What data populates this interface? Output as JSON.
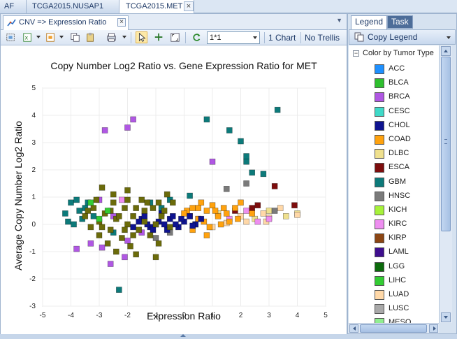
{
  "doc_tabs": [
    {
      "label": "AF"
    },
    {
      "label": "TCGA2015.NUSAP1"
    },
    {
      "label": "TCGA2015.MET"
    }
  ],
  "chart_tab": {
    "label": "CNV => Expression Ratio",
    "close": "×"
  },
  "toolbar": {
    "layout_value": "1*1",
    "chart_count_label": "1 Chart",
    "trellis_label": "No Trellis"
  },
  "right_panel": {
    "tabs": [
      {
        "label": "Legend"
      },
      {
        "label": "Task"
      }
    ],
    "copy_legend_label": "Copy Legend",
    "legend_title": "Color by Tumor Type",
    "legend_items": [
      {
        "label": "ACC",
        "color": "#1e90ff"
      },
      {
        "label": "BLCA",
        "color": "#2ebf2e"
      },
      {
        "label": "BRCA",
        "color": "#b057e3"
      },
      {
        "label": "CESC",
        "color": "#3fd9c8"
      },
      {
        "label": "CHOL",
        "color": "#0e1390"
      },
      {
        "label": "COAD",
        "color": "#ffa20e"
      },
      {
        "label": "DLBC",
        "color": "#efe08e"
      },
      {
        "label": "ESCA",
        "color": "#7d0d0d"
      },
      {
        "label": "GBM",
        "color": "#0c7a7a"
      },
      {
        "label": "HNSC",
        "color": "#7a7a7a"
      },
      {
        "label": "KICH",
        "color": "#a6f23a"
      },
      {
        "label": "KIRC",
        "color": "#ee8ef0"
      },
      {
        "label": "KIRP",
        "color": "#8b4513"
      },
      {
        "label": "LAML",
        "color": "#3e0e8e"
      },
      {
        "label": "LGG",
        "color": "#0c6a0c"
      },
      {
        "label": "LIHC",
        "color": "#33cc33"
      },
      {
        "label": "LUAD",
        "color": "#ffd8a8"
      },
      {
        "label": "LUSC",
        "color": "#a9a9a9"
      },
      {
        "label": "MESO",
        "color": "#90ee90"
      }
    ]
  },
  "chart_data": {
    "type": "scatter",
    "title": "Copy Number Log2 Ratio vs. Gene Expression Ratio for MET",
    "xlabel": "Expression Ratio",
    "ylabel": "Average Copy Number Log2 Ratio",
    "xlim": [
      -5,
      5
    ],
    "ylim": [
      -3,
      5
    ],
    "xticks": [
      "-5",
      "-4",
      "-3",
      "-2",
      "-1",
      "0",
      "1",
      "2",
      "3",
      "4",
      "5"
    ],
    "yticks": [
      "-3",
      "-2",
      "-1",
      "0",
      "1",
      "2",
      "3",
      "4",
      "5"
    ],
    "grid": true,
    "legend_placement": "side panel",
    "series": [
      {
        "label": "ESCA",
        "color": "#7d0d0d",
        "points": [
          [
            3.2,
            1.4
          ],
          [
            2.4,
            0.6
          ],
          [
            3.9,
            0.7
          ],
          [
            2.6,
            0.7
          ],
          [
            1.8,
            0.5
          ]
        ]
      },
      {
        "label": "DLBC",
        "color": "#efe08e",
        "points": [
          [
            3.6,
            0.3
          ],
          [
            3.0,
            0.5
          ],
          [
            2.5,
            0.2
          ],
          [
            4.0,
            0.4
          ],
          [
            1.2,
            0.4
          ]
        ]
      },
      {
        "label": "LUAD",
        "color": "#ffd8a8",
        "points": [
          [
            4.0,
            0.35
          ],
          [
            2.8,
            0.4
          ],
          [
            3.4,
            0.6
          ],
          [
            2.2,
            0.1
          ],
          [
            1.5,
            0.05
          ],
          [
            2.0,
            0.3
          ],
          [
            2.9,
            0.1
          ],
          [
            1.0,
            -0.1
          ],
          [
            3.0,
            0.25
          ]
        ]
      },
      {
        "label": "BRCA",
        "color": "#b057e3",
        "points": [
          [
            -2.8,
            3.45
          ],
          [
            -2.0,
            3.55
          ],
          [
            -1.8,
            3.85
          ],
          [
            1.0,
            2.3
          ],
          [
            -2.9,
            -0.85
          ],
          [
            -2.6,
            -1.45
          ],
          [
            -2.1,
            -1.2
          ],
          [
            -3.0,
            0.9
          ],
          [
            -3.3,
            -0.7
          ],
          [
            -2.0,
            -0.6
          ],
          [
            0.5,
            0.2
          ],
          [
            -1.5,
            -0.3
          ],
          [
            -2.5,
            0.3
          ],
          [
            -3.8,
            -0.9
          ]
        ]
      },
      {
        "label": "KIRC",
        "color": "#ee8ef0",
        "points": [
          [
            2.6,
            0.1
          ],
          [
            3.0,
            0.2
          ],
          [
            1.6,
            0.2
          ],
          [
            -2.2,
            0.9
          ],
          [
            2.2,
            0.5
          ]
        ]
      },
      {
        "label": "HNSC",
        "color": "#7a7a7a",
        "points": [
          [
            2.2,
            1.5
          ],
          [
            3.2,
            0.5
          ],
          [
            -1.0,
            -0.5
          ],
          [
            1.5,
            1.3
          ],
          [
            -0.5,
            -0.3
          ]
        ]
      },
      {
        "label": "COAD",
        "color": "#ffa20e",
        "points": [
          [
            0.3,
            0.6
          ],
          [
            0.8,
            0.5
          ],
          [
            1.2,
            0.3
          ],
          [
            0.5,
            0.2
          ],
          [
            1.0,
            0.7
          ],
          [
            0.2,
            0.3
          ],
          [
            1.5,
            0.4
          ],
          [
            0.7,
            0.1
          ],
          [
            1.8,
            0.6
          ],
          [
            0.9,
            -0.1
          ],
          [
            0.1,
            0.5
          ],
          [
            1.3,
            0.0
          ],
          [
            0.6,
            0.8
          ],
          [
            0.4,
            0.0
          ],
          [
            1.1,
            0.5
          ],
          [
            2.0,
            0.8
          ],
          [
            0.8,
            -0.4
          ],
          [
            1.6,
            0.1
          ],
          [
            0.5,
            0.6
          ],
          [
            0.0,
            0.4
          ],
          [
            1.4,
            0.6
          ],
          [
            0.3,
            -0.2
          ],
          [
            1.9,
            0.2
          ],
          [
            2.4,
            0.4
          ]
        ]
      },
      {
        "label": "GBM",
        "color": "#0c7a7a",
        "points": [
          [
            3.3,
            4.2
          ],
          [
            0.8,
            3.85
          ],
          [
            1.6,
            3.45
          ],
          [
            2.0,
            3.05
          ],
          [
            2.2,
            2.5
          ],
          [
            2.2,
            2.3
          ],
          [
            2.4,
            1.9
          ],
          [
            2.8,
            1.85
          ],
          [
            -4.0,
            0.8
          ],
          [
            -3.8,
            0.9
          ],
          [
            -3.5,
            0.6
          ],
          [
            -4.2,
            0.4
          ],
          [
            -3.6,
            0.2
          ],
          [
            -3.9,
            0.0
          ],
          [
            -3.7,
            0.5
          ],
          [
            -3.4,
            0.8
          ],
          [
            -4.1,
            0.1
          ],
          [
            -3.2,
            0.3
          ],
          [
            -1.2,
            0.8
          ],
          [
            0.2,
            1.05
          ],
          [
            -0.8,
            0.6
          ],
          [
            -2.5,
            -0.3
          ],
          [
            -2.3,
            -2.4
          ],
          [
            -0.5,
            0.9
          ]
        ]
      },
      {
        "label": "CHOL",
        "color": "#0e1390",
        "points": [
          [
            -0.5,
            0.2
          ],
          [
            -1.0,
            0.0
          ],
          [
            0.0,
            0.1
          ],
          [
            -1.5,
            0.2
          ],
          [
            -0.2,
            -0.1
          ],
          [
            -0.8,
            0.4
          ],
          [
            0.4,
            0.0
          ],
          [
            -1.2,
            -0.1
          ],
          [
            -0.6,
            -0.2
          ],
          [
            -1.6,
            0.1
          ],
          [
            0.2,
            0.3
          ],
          [
            -0.3,
            0.0
          ],
          [
            -1.4,
            0.3
          ],
          [
            -0.9,
            0.1
          ],
          [
            0.6,
            0.2
          ],
          [
            -0.1,
            0.2
          ],
          [
            -1.1,
            -0.2
          ],
          [
            -0.7,
            0.0
          ],
          [
            -1.8,
            -0.1
          ],
          [
            0.3,
            -0.05
          ],
          [
            -0.4,
            0.3
          ],
          [
            -1.3,
            0.0
          ]
        ]
      },
      {
        "label": "LGG",
        "color": "#6b6b0a",
        "points": [
          [
            -2.9,
            1.35
          ],
          [
            -2.0,
            1.25
          ],
          [
            -0.6,
            1.1
          ],
          [
            -0.9,
            0.8
          ],
          [
            -1.5,
            0.9
          ],
          [
            -2.5,
            0.8
          ],
          [
            -3.2,
            0.6
          ],
          [
            -2.1,
            0.6
          ],
          [
            -1.1,
            0.6
          ],
          [
            -2.8,
            0.4
          ],
          [
            -1.8,
            0.3
          ],
          [
            -0.8,
            0.3
          ],
          [
            -3.5,
            0.3
          ],
          [
            -2.4,
            0.2
          ],
          [
            -1.4,
            0.1
          ],
          [
            -3.0,
            0.1
          ],
          [
            -2.0,
            0.0
          ],
          [
            -1.0,
            0.0
          ],
          [
            -3.3,
            -0.1
          ],
          [
            -2.6,
            -0.2
          ],
          [
            -1.6,
            -0.2
          ],
          [
            -0.5,
            -0.1
          ],
          [
            -3.0,
            -0.4
          ],
          [
            -2.2,
            -0.5
          ],
          [
            -1.2,
            -0.4
          ],
          [
            -2.7,
            -0.7
          ],
          [
            -1.9,
            -0.8
          ],
          [
            -0.9,
            -0.7
          ],
          [
            -2.4,
            -1.0
          ],
          [
            -1.7,
            -1.1
          ],
          [
            -2.0,
            0.9
          ],
          [
            -1.4,
            0.5
          ],
          [
            -2.6,
            0.5
          ],
          [
            -3.1,
            0.9
          ],
          [
            -0.4,
            0.8
          ],
          [
            -1.8,
            -0.4
          ],
          [
            -2.3,
            0.3
          ],
          [
            -1.3,
            0.8
          ],
          [
            -0.7,
            0.5
          ],
          [
            -2.9,
            -0.1
          ],
          [
            -1.0,
            -1.2
          ],
          [
            -2.5,
            1.1
          ],
          [
            -1.7,
            0.6
          ],
          [
            -3.4,
            0.5
          ],
          [
            -2.1,
            -0.2
          ]
        ]
      },
      {
        "label": "LIHC",
        "color": "#33cc33",
        "points": [
          [
            -3.3,
            0.8
          ],
          [
            -3.0,
            0.2
          ],
          [
            -2.7,
            0.5
          ]
        ]
      }
    ]
  }
}
